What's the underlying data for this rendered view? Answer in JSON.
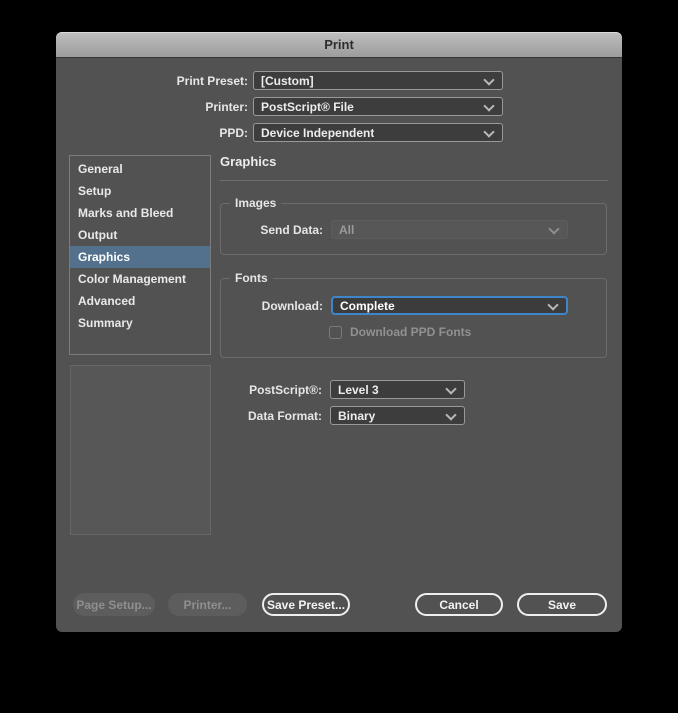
{
  "window": {
    "title": "Print"
  },
  "top_fields": [
    {
      "label": "Print Preset:",
      "value": "[Custom]"
    },
    {
      "label": "Printer:",
      "value": "PostScript® File"
    },
    {
      "label": "PPD:",
      "value": "Device Independent"
    }
  ],
  "sidebar": {
    "items": [
      "General",
      "Setup",
      "Marks and Bleed",
      "Output",
      "Graphics",
      "Color Management",
      "Advanced",
      "Summary"
    ],
    "selected_index": 4
  },
  "panel": {
    "title": "Graphics",
    "images_group": {
      "legend": "Images",
      "send_data_label": "Send Data:",
      "send_data_value": "All"
    },
    "fonts_group": {
      "legend": "Fonts",
      "download_label": "Download:",
      "download_value": "Complete",
      "ppd_fonts_label": "Download PPD Fonts"
    },
    "postscript_label": "PostScript®:",
    "postscript_value": "Level 3",
    "data_format_label": "Data Format:",
    "data_format_value": "Binary"
  },
  "footer": {
    "page_setup": "Page Setup...",
    "printer": "Printer...",
    "save_preset": "Save Preset...",
    "cancel": "Cancel",
    "save": "Save"
  },
  "colors": {
    "accent_blue": "#3e85c9",
    "selection_blue": "#53708d",
    "dialog_bg": "#525252"
  }
}
